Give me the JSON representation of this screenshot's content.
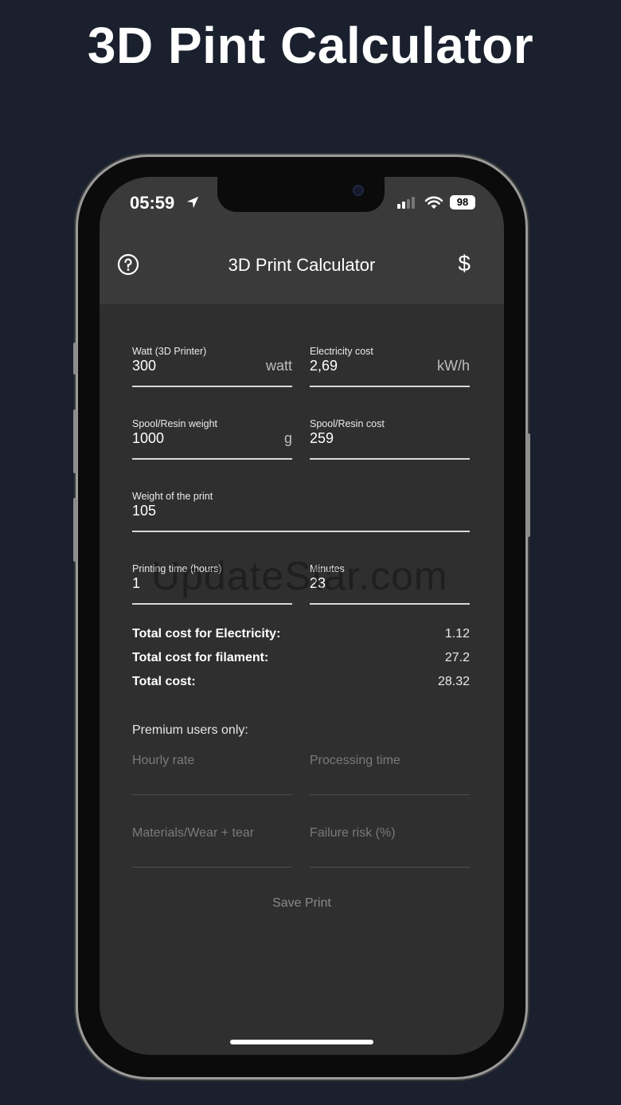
{
  "headline": "3D Pint Calculator",
  "status_bar": {
    "time": "05:59",
    "battery": "98"
  },
  "app_bar": {
    "title": "3D Print Calculator",
    "currency_symbol": "$"
  },
  "fields": {
    "watt": {
      "label": "Watt (3D Printer)",
      "value": "300",
      "suffix": "watt"
    },
    "electricity_cost": {
      "label": "Electricity cost",
      "value": "2,69",
      "suffix": "kW/h"
    },
    "spool_weight": {
      "label": "Spool/Resin weight",
      "value": "1000",
      "suffix": "g"
    },
    "spool_cost": {
      "label": "Spool/Resin cost",
      "value": "259"
    },
    "print_weight": {
      "label": "Weight of the print",
      "value": "105"
    },
    "print_hours": {
      "label": "Printing time (hours)",
      "value": "1"
    },
    "print_minutes": {
      "label": "Minutes",
      "value": "23"
    }
  },
  "summary": {
    "electricity_label": "Total cost for Electricity:",
    "electricity_value": "1.12",
    "filament_label": "Total cost for filament:",
    "filament_value": "27.2",
    "total_label": "Total cost:",
    "total_value": "28.32"
  },
  "premium": {
    "heading": "Premium users only:",
    "hourly_rate": "Hourly rate",
    "processing_time": "Processing time",
    "materials_wear": "Materials/Wear + tear",
    "failure_risk": "Failure risk (%)"
  },
  "save_button": "Save Print",
  "watermark": "UpdateStar.com",
  "colors": {
    "background": "#1a202d",
    "screen": "#2f2f2f",
    "app_bar": "#3a3a3a"
  }
}
